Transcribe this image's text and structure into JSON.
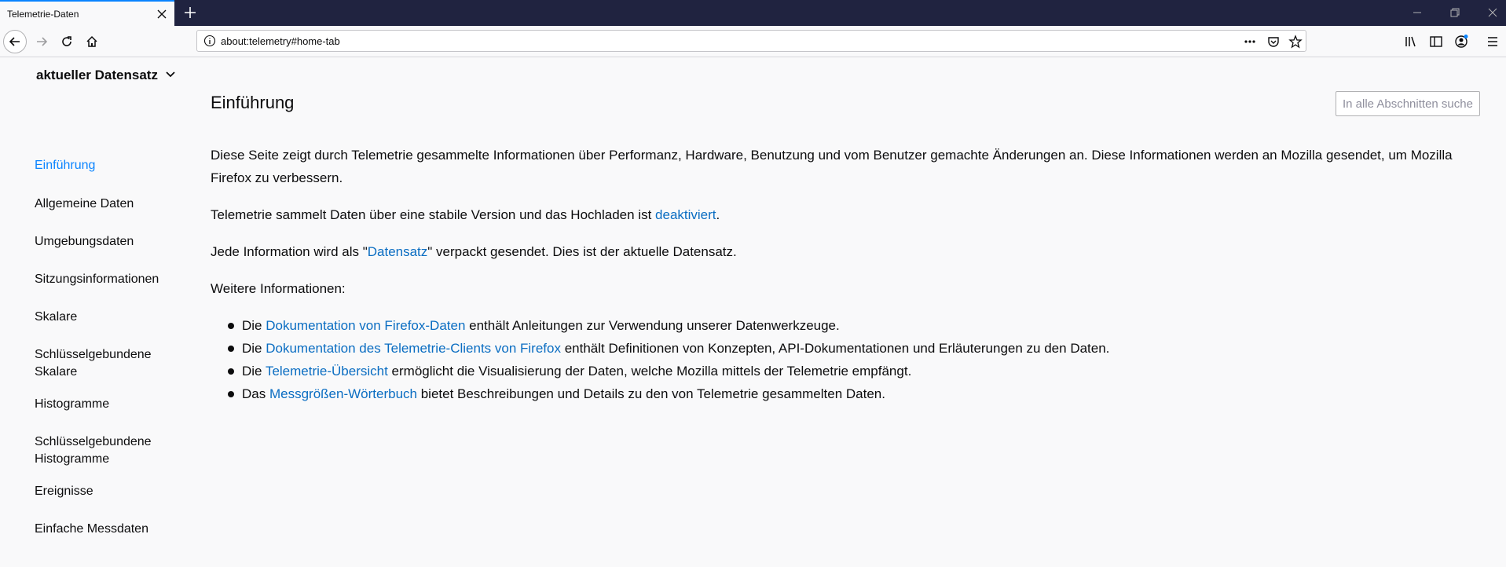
{
  "browser": {
    "tab_title": "Telemetrie-Daten",
    "url": "about:telemetry#home-tab"
  },
  "sidebar": {
    "category": "aktueller Datensatz",
    "items": [
      {
        "label": "Einführung",
        "active": true
      },
      {
        "label": "Allgemeine Daten"
      },
      {
        "label": "Umgebungsdaten"
      },
      {
        "label": "Sitzungsinformationen"
      },
      {
        "label": "Skalare"
      },
      {
        "label": "Schlüsselgebundene Skalare"
      },
      {
        "label": "Histogramme"
      },
      {
        "label": "Schlüsselgebundene Histogramme"
      },
      {
        "label": "Ereignisse"
      },
      {
        "label": "Einfache Messdaten"
      }
    ]
  },
  "main": {
    "title": "Einführung",
    "search_placeholder": "In alle Abschnitten suchen",
    "intro": "Diese Seite zeigt durch Telemetrie gesammelte Informationen über Performanz, Hardware, Benutzung und vom Benutzer gemachte Änderungen an. Diese Informationen werden an Mozilla gesendet, um Mozilla Firefox zu verbessern.",
    "upload_pre": "Telemetrie sammelt Daten über eine stabile Version und das Hochladen ist ",
    "upload_link": "deaktiviert",
    "upload_post": ".",
    "ping_pre": "Jede Information wird als \"",
    "ping_link": "Datensatz",
    "ping_post": "\" verpackt gesendet. Dies ist der aktuelle Datensatz.",
    "more_info": "Weitere Informationen:",
    "bullets": [
      {
        "pre": "Die ",
        "link": "Dokumentation von Firefox-Daten",
        "post": " enthält Anleitungen zur Verwendung unserer Datenwerkzeuge."
      },
      {
        "pre": "Die ",
        "link": "Dokumentation des Telemetrie-Clients von Firefox",
        "post": " enthält Definitionen von Konzepten, API-Dokumentationen und Erläuterungen zu den Daten."
      },
      {
        "pre": "Die ",
        "link": "Telemetrie-Übersicht",
        "post": " ermöglicht die Visualisierung der Daten, welche Mozilla mittels der Telemetrie empfängt."
      },
      {
        "pre": "Das ",
        "link": "Messgrößen-Wörterbuch",
        "post": " bietet Beschreibungen und Details zu den von Telemetrie gesammelten Daten."
      }
    ]
  }
}
